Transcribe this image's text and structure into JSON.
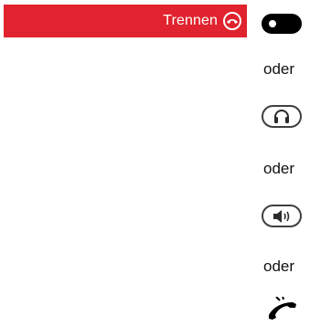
{
  "disconnect": {
    "label": "Trennen",
    "icon": "hangup-icon",
    "color": "#e0232e"
  },
  "keys": {
    "pill_icon": "oval-key-icon",
    "headset_icon": "headset-icon",
    "speaker_icon": "speaker-icon",
    "handset_icon": "handset-icon"
  },
  "separators": [
    "oder",
    "oder",
    "oder"
  ]
}
